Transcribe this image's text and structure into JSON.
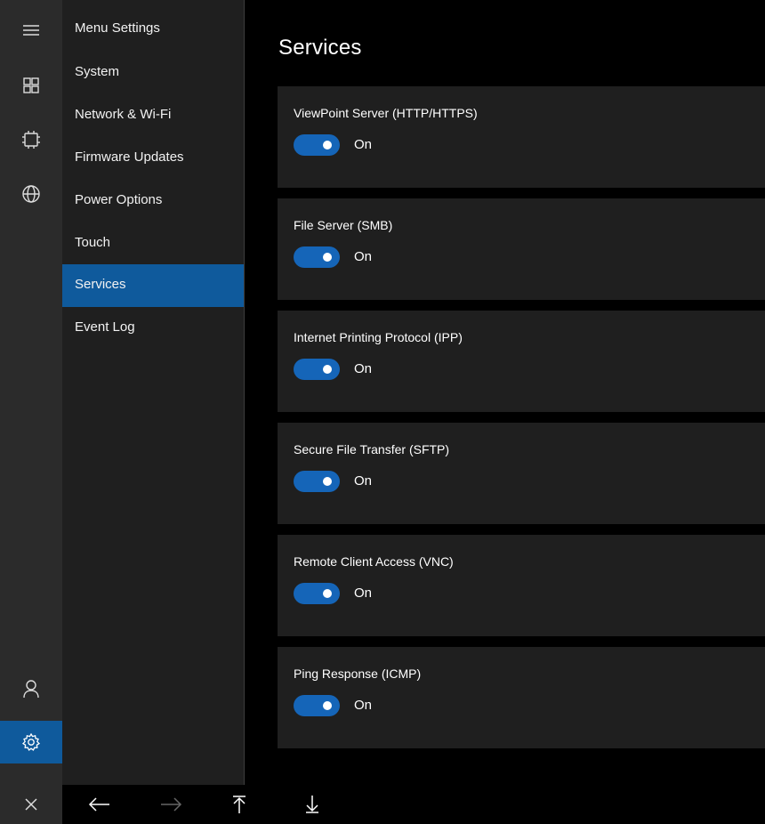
{
  "rail": {
    "icons": [
      "hamburger-icon",
      "grid-icon",
      "chip-icon",
      "globe-icon",
      "user-icon",
      "gear-icon"
    ],
    "active": "gear-icon"
  },
  "menu": {
    "items": [
      {
        "label": "Menu Settings"
      },
      {
        "label": "System"
      },
      {
        "label": "Network & Wi-Fi"
      },
      {
        "label": "Firmware Updates"
      },
      {
        "label": "Power Options"
      },
      {
        "label": "Touch"
      },
      {
        "label": "Services"
      },
      {
        "label": "Event Log"
      }
    ],
    "selected": "Services"
  },
  "page": {
    "title": "Services"
  },
  "services": [
    {
      "name": "ViewPoint Server (HTTP/HTTPS)",
      "state": "On",
      "enabled": true
    },
    {
      "name": "File Server (SMB)",
      "state": "On",
      "enabled": true
    },
    {
      "name": "Internet Printing Protocol (IPP)",
      "state": "On",
      "enabled": true
    },
    {
      "name": "Secure File Transfer (SFTP)",
      "state": "On",
      "enabled": true
    },
    {
      "name": "Remote Client Access (VNC)",
      "state": "On",
      "enabled": true
    },
    {
      "name": "Ping Response (ICMP)",
      "state": "On",
      "enabled": true
    }
  ],
  "bottombar": {
    "icons": [
      "close-icon",
      "back-arrow-icon",
      "forward-arrow-icon",
      "scroll-top-icon",
      "scroll-bottom-icon"
    ]
  },
  "colors": {
    "accent": "#0f5a9c",
    "toggle_on": "#1565b8",
    "rail_bg": "#2b2b2b",
    "menu_bg": "#1f1f1f",
    "card_bg": "#1f1f1f"
  }
}
